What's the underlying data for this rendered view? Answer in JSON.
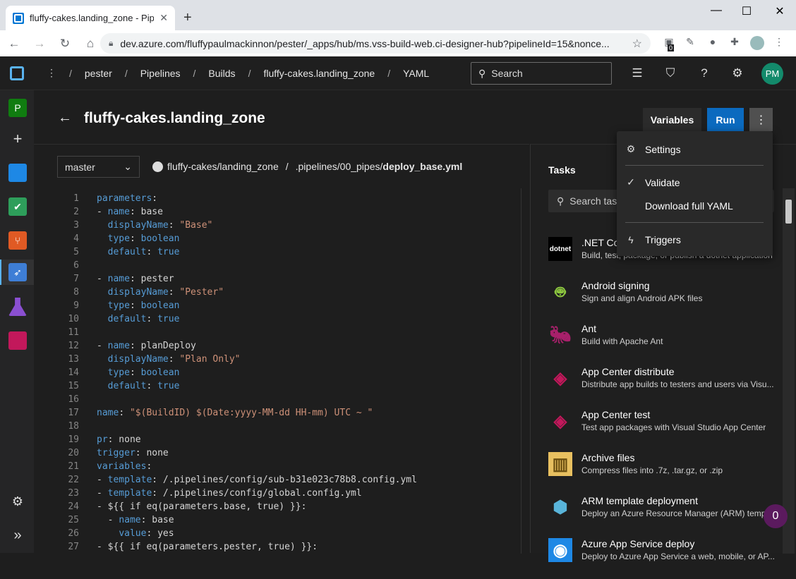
{
  "browser": {
    "tab_title": "fluffy-cakes.landing_zone - Pipeli...",
    "url": "dev.azure.com/fluffypaulmackinnon/pester/_apps/hub/ms.vss-build-web.ci-designer-hub?pipelineId=15&nonce...",
    "new_tab": "+",
    "close_tab": "✕",
    "min": "—",
    "max": "☐",
    "close": "✕",
    "ext_badge": "0"
  },
  "topbar": {
    "breadcrumb": [
      "pester",
      "Pipelines",
      "Builds",
      "fluffy-cakes.landing_zone",
      "YAML"
    ],
    "search_placeholder": "Search",
    "avatar_initials": "PM"
  },
  "leftnav": {
    "project_initial": "P"
  },
  "header": {
    "title": "fluffy-cakes.landing_zone",
    "variables": "Variables",
    "run": "Run",
    "more": "⋮"
  },
  "editor": {
    "branch": "master",
    "repo": "fluffy-cakes/landing_zone",
    "path_sep": "/",
    "path_dir": ".pipelines/00_pipes/",
    "path_file": "deploy_base.yml"
  },
  "code_lines": [
    {
      "n": "1",
      "t": "parameters:"
    },
    {
      "n": "2",
      "t": "- name: base"
    },
    {
      "n": "3",
      "t": "  displayName: \"Base\""
    },
    {
      "n": "4",
      "t": "  type: boolean"
    },
    {
      "n": "5",
      "t": "  default: true"
    },
    {
      "n": "6",
      "t": ""
    },
    {
      "n": "7",
      "t": "- name: pester"
    },
    {
      "n": "8",
      "t": "  displayName: \"Pester\""
    },
    {
      "n": "9",
      "t": "  type: boolean"
    },
    {
      "n": "10",
      "t": "  default: true"
    },
    {
      "n": "11",
      "t": ""
    },
    {
      "n": "12",
      "t": "- name: planDeploy"
    },
    {
      "n": "13",
      "t": "  displayName: \"Plan Only\""
    },
    {
      "n": "14",
      "t": "  type: boolean"
    },
    {
      "n": "15",
      "t": "  default: true"
    },
    {
      "n": "16",
      "t": ""
    },
    {
      "n": "17",
      "t": "name: \"$(BuildID) $(Date:yyyy-MM-dd HH-mm) UTC ~ \""
    },
    {
      "n": "18",
      "t": ""
    },
    {
      "n": "19",
      "t": "pr: none"
    },
    {
      "n": "20",
      "t": "trigger: none"
    },
    {
      "n": "21",
      "t": "variables:"
    },
    {
      "n": "22",
      "t": "- template: /.pipelines/config/sub-b31e023c78b8.config.yml"
    },
    {
      "n": "23",
      "t": "- template: /.pipelines/config/global.config.yml"
    },
    {
      "n": "24",
      "t": "- ${{ if eq(parameters.base, true) }}:"
    },
    {
      "n": "25",
      "t": "  - name: base"
    },
    {
      "n": "26",
      "t": "    value: yes"
    },
    {
      "n": "27",
      "t": "- ${{ if eq(parameters.pester, true) }}:"
    }
  ],
  "tasks": {
    "heading": "Tasks",
    "search_placeholder": "Search tasks",
    "items": [
      {
        "name": "NET Core",
        "desc": "Build, test, package, or publish a dotnet application",
        "icon_label": "dotnet"
      },
      {
        "name": "Android signing",
        "desc": "Sign and align Android APK files"
      },
      {
        "name": "Ant",
        "desc": "Build with Apache Ant"
      },
      {
        "name": "App Center distribute",
        "desc": "Distribute app builds to testers and users via Visu..."
      },
      {
        "name": "App Center test",
        "desc": "Test app packages with Visual Studio App Center"
      },
      {
        "name": "Archive files",
        "desc": "Compress files into .7z, .tar.gz, or .zip"
      },
      {
        "name": "ARM template deployment",
        "desc": "Deploy an Azure Resource Manager (ARM) templ..."
      },
      {
        "name": "Azure App Service deploy",
        "desc": "Deploy to Azure App Service a web, mobile, or AP..."
      }
    ]
  },
  "menu": {
    "settings": "Settings",
    "validate": "Validate",
    "download": "Download full YAML",
    "triggers": "Triggers"
  },
  "badge": "0"
}
